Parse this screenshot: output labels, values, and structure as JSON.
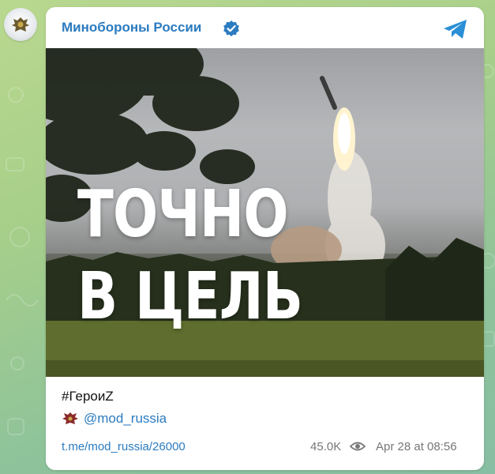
{
  "channel": {
    "name": "Минобороны России",
    "verified": true,
    "accent_color": "#2b7bc0"
  },
  "post": {
    "image_text_line1": "ТОЧНО",
    "image_text_line2": "В ЦЕЛЬ",
    "hashtag": "#ГероиZ",
    "mention": "@mod_russia",
    "link": "t.me/mod_russia/26000",
    "views": "45.0K",
    "date": "Apr 28 at 08:56"
  },
  "icons": {
    "avatar": "emblem-icon",
    "verified": "verified-badge-icon",
    "telegram": "telegram-icon",
    "views": "eye-icon",
    "mention": "emblem-icon"
  }
}
